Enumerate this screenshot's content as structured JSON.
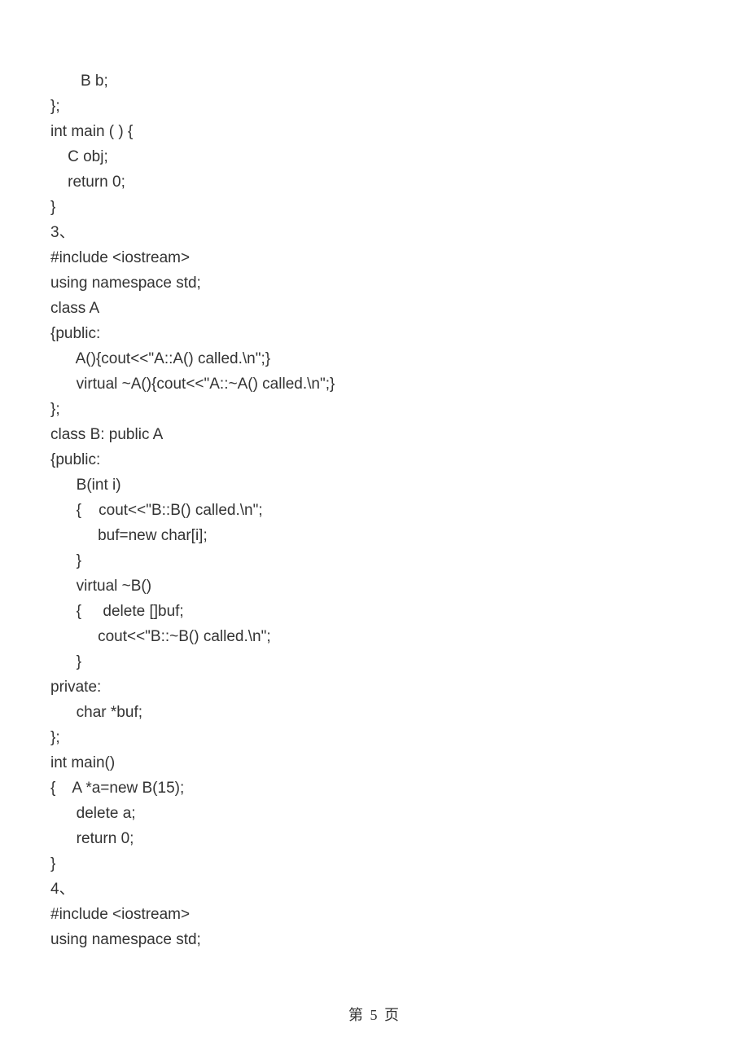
{
  "lines": [
    "       B b;",
    "};",
    "int main ( ) {",
    "    C obj;",
    "    return 0;",
    "}",
    "3、",
    "#include <iostream>",
    "using namespace std;",
    "class A",
    "{public:",
    "      A(){cout<<\"A::A() called.\\n\";}",
    "      virtual ~A(){cout<<\"A::~A() called.\\n\";}",
    "};",
    "class B: public A",
    "{public:",
    "      B(int i)",
    "      {    cout<<\"B::B() called.\\n\";",
    "           buf=new char[i];",
    "      }",
    "      virtual ~B()",
    "      {     delete []buf;",
    "           cout<<\"B::~B() called.\\n\";",
    "      }",
    "private:",
    "      char *buf;",
    "};",
    "int main()",
    "{    A *a=new B(15);",
    "      delete a;",
    "      return 0;",
    "}",
    "4、",
    "#include <iostream>",
    "using namespace std;"
  ],
  "footer": "第 5 页"
}
